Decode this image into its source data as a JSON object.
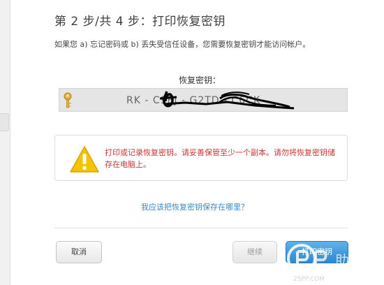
{
  "page": {
    "title": "第 2 步/共 4 步：打印恢复密钥",
    "subtitle": "如果您 a) 忘记密码或 b) 丢失受信任设备，您需要恢复密钥才能访问帐户。"
  },
  "recovery_key": {
    "label": "恢复密钥：",
    "value": "RK - C9EJ - G2TD - C6CK",
    "icon": "key-icon",
    "redacted": true
  },
  "warning": {
    "icon": "warning-icon",
    "text": "打印或记录恢复密钥。请妥善保管至少一个副本。请勿将恢复密钥储存在电脑上。"
  },
  "help_link": "我应该把恢复密钥保存在哪里？",
  "buttons": {
    "cancel": "取消",
    "continue": "继续",
    "print": "打印密钥"
  },
  "watermark": {
    "text": "助手",
    "url_text": "25PP.COM"
  },
  "colors": {
    "accent": "#3a88c8",
    "warning_text": "#cc3333",
    "warning_icon": "#f5c400",
    "print_button": "#2d88cf"
  }
}
